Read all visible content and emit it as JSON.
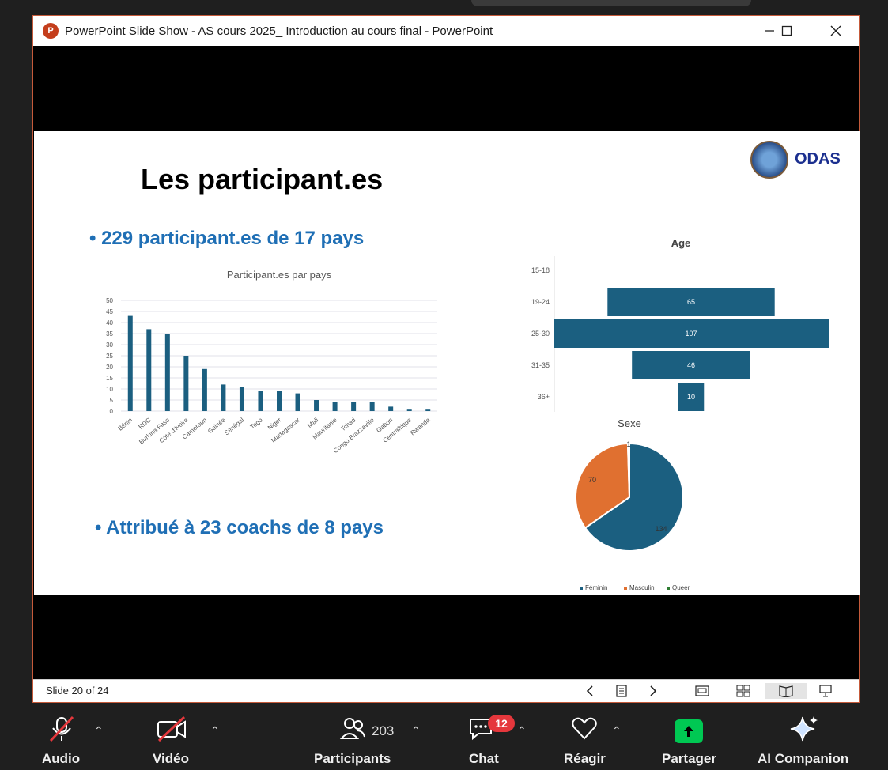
{
  "window": {
    "title": "PowerPoint Slide Show  -  AS cours 2025_ Introduction au cours final - PowerPoint"
  },
  "slide": {
    "title": "Les participant.es",
    "bullet1": "• 229 participant.es de 17 pays",
    "bullet2": "• Attribué à 23 coachs de 8 pays",
    "logo_text": "ODAS"
  },
  "status": {
    "slide_number": "Slide 20 of 24"
  },
  "zoom": {
    "audio_label": "Audio",
    "video_label": "Vidéo",
    "participants_count": "203",
    "participants_label": "Participants",
    "chat_badge": "12",
    "chat_label": "Chat",
    "react_label": "Réagir",
    "share_label": "Partager",
    "ai_label": "AI Companion"
  },
  "colors": {
    "accent": "#1f6fb5",
    "bar": "#1b5f80",
    "orange": "#e07030",
    "queer": "#2e7d32"
  },
  "chart_data": [
    {
      "type": "bar",
      "title": "Participant.es par pays",
      "categories": [
        "Bénin",
        "RDC",
        "Burkina Faso",
        "Côte d'Ivoire",
        "Cameroun",
        "Guinée",
        "Sénégal",
        "Togo",
        "Niger",
        "Madagascar",
        "Mali",
        "Mauritanie",
        "Tchad",
        "Congo Brazzaville",
        "Gabon",
        "Centrafrique",
        "Rwanda"
      ],
      "values": [
        43,
        37,
        35,
        25,
        19,
        12,
        11,
        9,
        9,
        8,
        5,
        4,
        4,
        4,
        2,
        1,
        1
      ],
      "ylim": [
        0,
        50
      ],
      "yticks": [
        0,
        5,
        10,
        15,
        20,
        25,
        30,
        35,
        40,
        45,
        50
      ],
      "grid": true
    },
    {
      "type": "bar",
      "orientation": "horizontal",
      "title": "Age",
      "categories": [
        "15-18",
        "19-24",
        "25-30",
        "31-35",
        "36+"
      ],
      "values": [
        0,
        65,
        107,
        46,
        10
      ]
    },
    {
      "type": "pie",
      "title": "Sexe",
      "labels": [
        "Féminin",
        "Masculin",
        "Queer"
      ],
      "values": [
        134,
        70,
        1
      ],
      "colors": [
        "#1b5f80",
        "#e07030",
        "#2e7d32"
      ],
      "legend": "bottom"
    }
  ]
}
